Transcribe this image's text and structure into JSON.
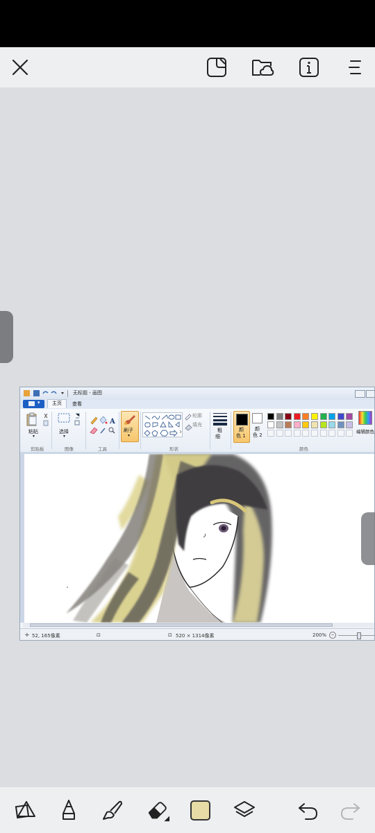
{
  "top_toolbar": {
    "icons": [
      "close-icon",
      "shape-edit-icon",
      "cloud-folder-icon",
      "info-icon",
      "menu-icon"
    ]
  },
  "paint_app": {
    "window_title": "无标题 - 画图",
    "tabs": [
      "主页",
      "查看"
    ],
    "ribbon": {
      "clipboard_label": "剪贴板",
      "paste_label": "粘贴",
      "image_label": "图像",
      "select_label": "选择",
      "tools_label": "工具",
      "brushes_label": "刷子",
      "shapes_label": "形状",
      "outline_label": "轮廓",
      "fill_label": "填充",
      "size_label_1": "粗",
      "size_label_2": "细",
      "color1_label_1": "颜",
      "color1_label_2": "色 1",
      "color2_label_1": "颜",
      "color2_label_2": "色 2",
      "colors_label": "颜色",
      "edit_colors_label": "编辑颜色"
    },
    "palette_row1": [
      "#000000",
      "#7f7f7f",
      "#880015",
      "#ed1c24",
      "#ff7f27",
      "#fff200",
      "#22b14c",
      "#00a2e8",
      "#3f48cc",
      "#a349a4"
    ],
    "palette_row2": [
      "#ffffff",
      "#c3c3c3",
      "#b97a57",
      "#ffaec9",
      "#ffc90e",
      "#efe4b0",
      "#b5e61d",
      "#99d9ea",
      "#7092be",
      "#c8bfe7"
    ],
    "status": {
      "cursor": "52, 165像素",
      "size": "520 × 1314像素",
      "zoom": "200%"
    }
  },
  "bottom_toolbar": {
    "icons": [
      "shapes-icon",
      "pencil-icon",
      "brush-icon",
      "eraser-icon",
      "color-swatch",
      "layers-icon",
      "undo-icon",
      "redo-icon"
    ],
    "current_color": "#e7dca5"
  }
}
